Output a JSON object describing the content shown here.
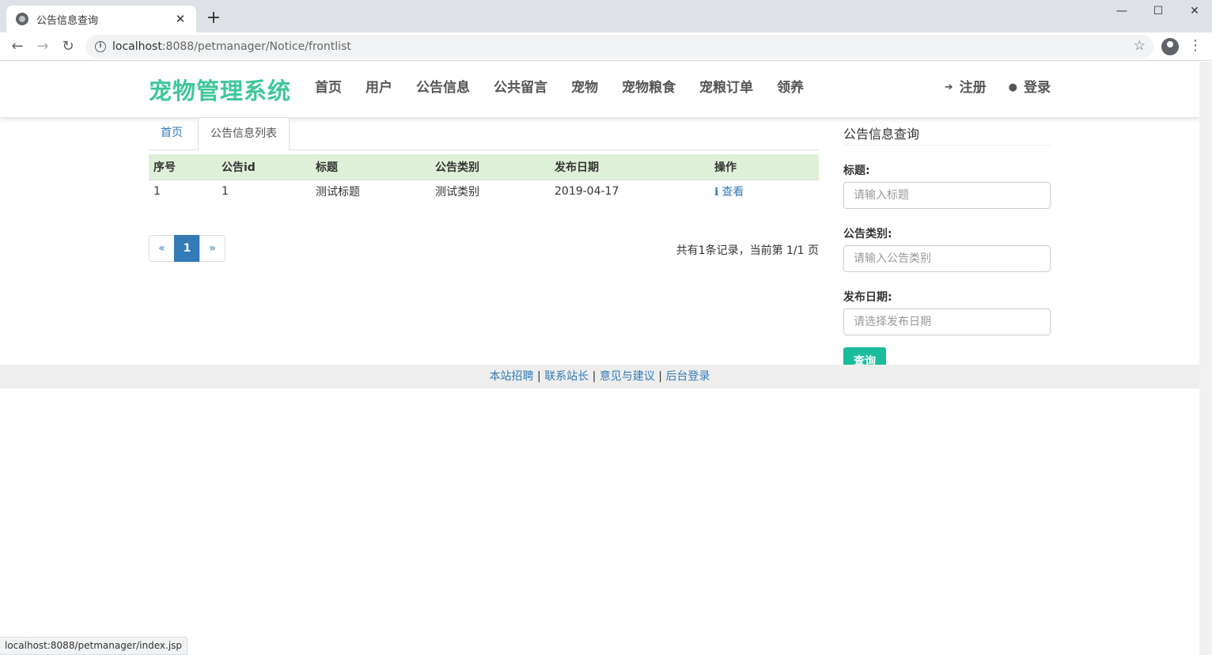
{
  "browser": {
    "tab_title": "公告信息查询",
    "url_host": "localhost",
    "url_rest": ":8088/petmanager/Notice/frontlist",
    "status_url": "localhost:8088/petmanager/index.jsp"
  },
  "header": {
    "brand": "宠物管理系统",
    "nav": [
      "首页",
      "用户",
      "公告信息",
      "公共留言",
      "宠物",
      "宠物粮食",
      "宠粮订单",
      "领养"
    ],
    "register": "注册",
    "login": "登录"
  },
  "tabs": {
    "home": "首页",
    "active": "公告信息列表"
  },
  "table": {
    "headers": [
      "序号",
      "公告id",
      "标题",
      "公告类别",
      "发布日期",
      "操作"
    ],
    "rows": [
      [
        "1",
        "1",
        "测试标题",
        "测试类别",
        "2019-04-17",
        "查看"
      ]
    ]
  },
  "pagination": {
    "prev": "«",
    "current": "1",
    "next": "»",
    "info": "共有1条记录，当前第 1/1 页"
  },
  "search": {
    "title": "公告信息查询",
    "title_label": "标题:",
    "title_placeholder": "请输入标题",
    "category_label": "公告类别:",
    "category_placeholder": "请输入公告类别",
    "date_label": "发布日期:",
    "date_placeholder": "请选择发布日期",
    "query_button": "查询"
  },
  "footer": {
    "links": [
      "本站招聘",
      "联系站长",
      "意见与建议",
      "后台登录"
    ],
    "separator": "|"
  },
  "colors": {
    "brand": "#3fc79a",
    "link": "#337ab7",
    "table_header": "#dff0d8",
    "query_button": "#1abc9c"
  }
}
